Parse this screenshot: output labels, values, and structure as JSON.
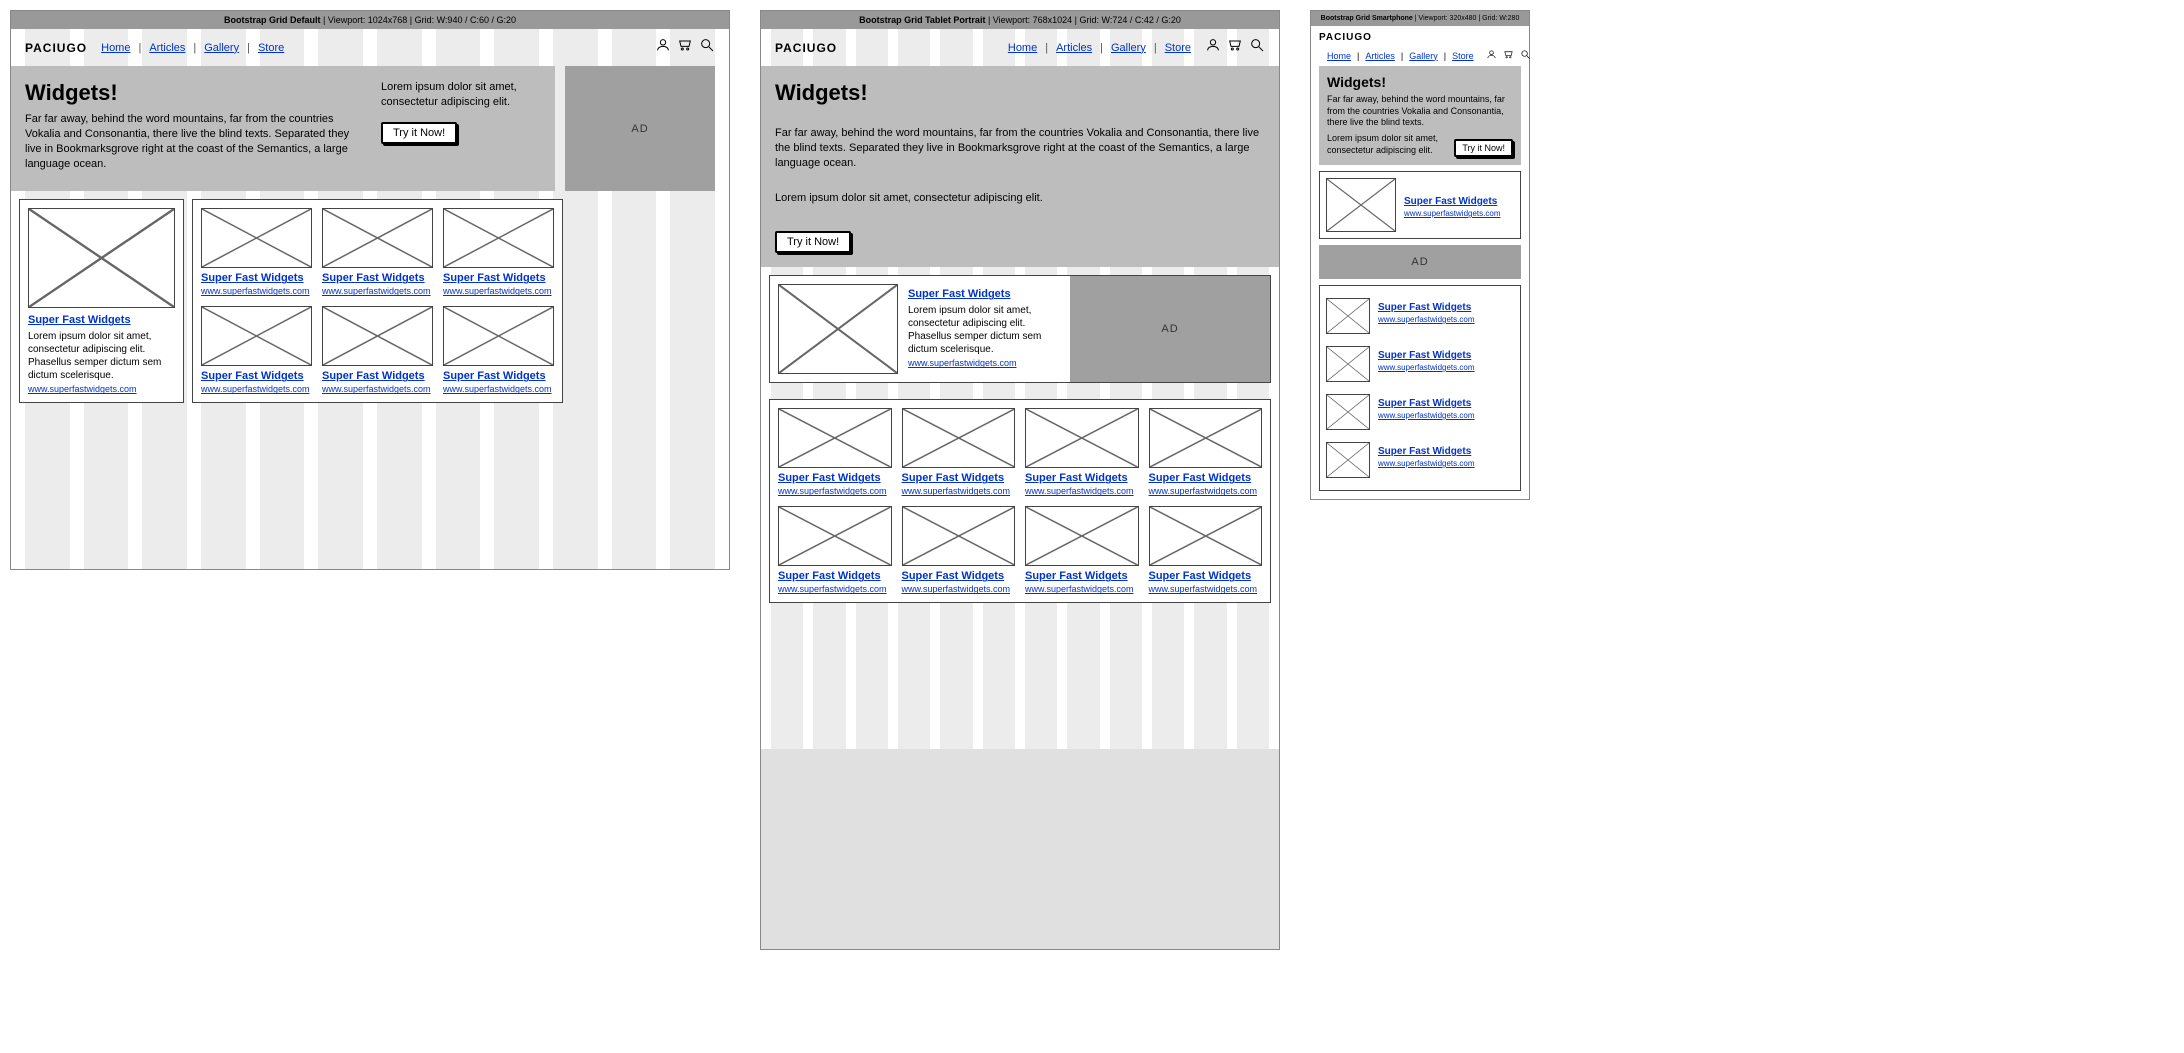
{
  "desktop": {
    "title_bold": "Bootstrap Grid Default",
    "title_rest": "  |  Viewport: 1024x768  |  Grid: W:940 / C:60 / G:20"
  },
  "tablet": {
    "title_bold": "Bootstrap Grid Tablet Portrait",
    "title_rest": "  |  Viewport: 768x1024  |  Grid: W:724 / C:42 / G:20"
  },
  "phone": {
    "title_bold": "Bootstrap Grid Smartphone",
    "title_rest": "  |  Viewport: 320x480  |  Grid: W:280"
  },
  "logo": "PACIUGO",
  "nav": {
    "home": "Home",
    "articles": "Articles",
    "gallery": "Gallery",
    "store": "Store"
  },
  "hero": {
    "title": "Widgets!",
    "body": "Far far away, behind the word mountains, far from the countries Vokalia and Consonantia, there live the blind texts. Separated they live in Bookmarksgrove right at the coast of the Semantics, a large language ocean.",
    "lorem": "Lorem ipsum dolor sit amet, consectetur adipiscing elit.",
    "cta": "Try it Now!"
  },
  "ad": "AD",
  "widget": {
    "title": "Super Fast Widgets",
    "desc": "Lorem ipsum dolor sit amet, consectetur adipiscing elit. Phasellus semper dictum sem dictum scelerisque.",
    "url": "www.superfastwidgets.com"
  },
  "phone_hero_body": "Far far away, behind the word mountains, far from the countries Vokalia and Consonantia, there live the blind texts."
}
